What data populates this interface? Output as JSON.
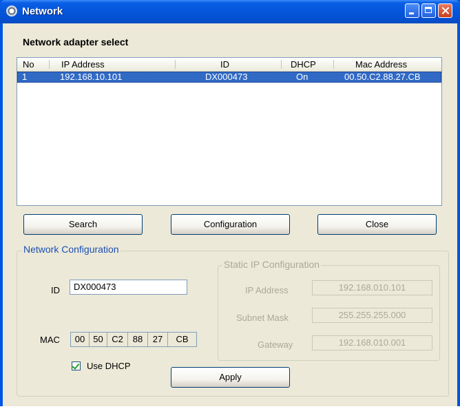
{
  "window": {
    "title": "Network"
  },
  "adapter_select": {
    "heading": "Network adapter select",
    "columns": [
      "No",
      "IP Address",
      "ID",
      "DHCP",
      "Mac Address"
    ],
    "rows": [
      {
        "no": "1",
        "ip": "192.168.10.101",
        "id": "DX000473",
        "dhcp": "On",
        "mac": "00.50.C2.88.27.CB",
        "selected": true
      }
    ]
  },
  "buttons": {
    "search": "Search",
    "configuration": "Configuration",
    "close": "Close",
    "apply": "Apply"
  },
  "network_config": {
    "legend": "Network Configuration",
    "id_label": "ID",
    "id_value": "DX000473",
    "mac_label": "MAC",
    "mac_octets": [
      "00",
      "50",
      "C2",
      "88",
      "27",
      "CB"
    ],
    "use_dhcp_label": "Use DHCP",
    "use_dhcp_checked": true
  },
  "static_ip": {
    "legend": "Static IP Configuration",
    "ip_label": "IP Address",
    "ip_value": "192.168.010.101",
    "mask_label": "Subnet Mask",
    "mask_value": "255.255.255.000",
    "gateway_label": "Gateway",
    "gateway_value": "192.168.010.001"
  },
  "colors": {
    "title_bar": "#0a5fe6",
    "selection": "#316ac5",
    "dialog_bg": "#ece9d8"
  },
  "icons": {
    "app": "network-gear-icon",
    "minimize": "minimize-icon",
    "maximize": "maximize-icon",
    "close": "close-icon",
    "check": "checkmark-icon"
  }
}
